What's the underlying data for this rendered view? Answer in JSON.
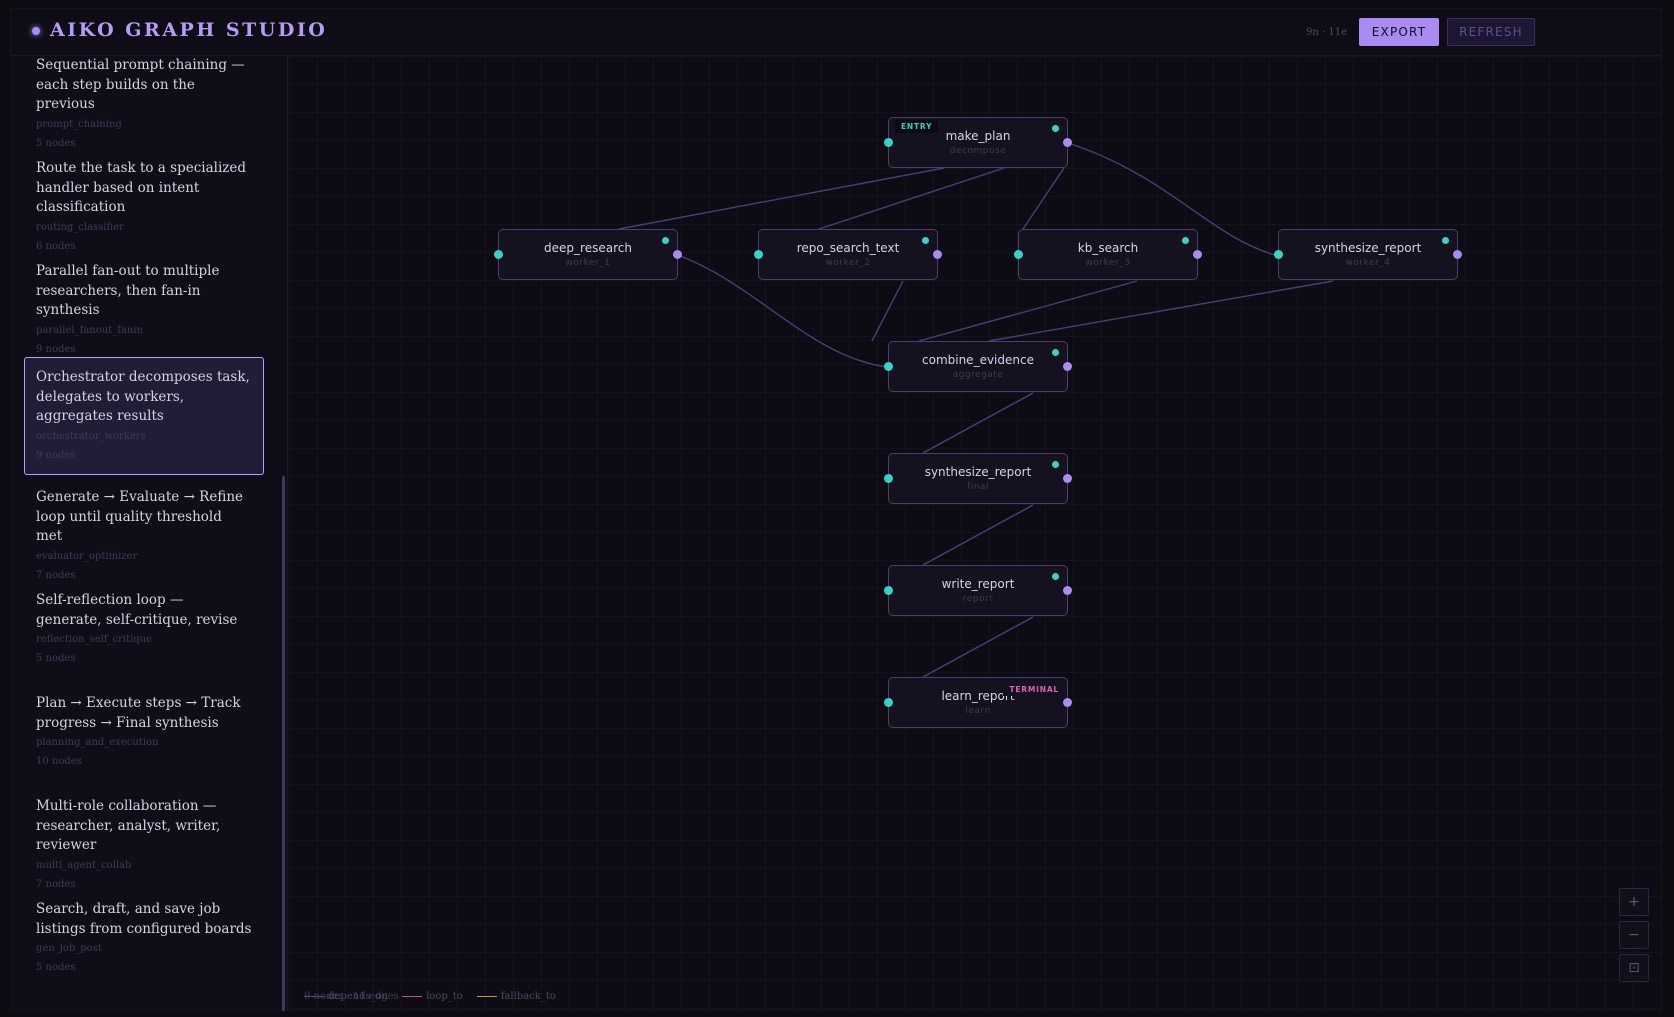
{
  "app": {
    "title": "AIKO GRAPH STUDIO",
    "counts": "9n · 11e"
  },
  "toolbar": {
    "export_label": "EXPORT",
    "refresh_label": "REFRESH"
  },
  "sidebar": {
    "items": [
      {
        "description": "Sequential prompt chaining — each step builds on the previous",
        "id": "prompt_chaining",
        "count": "5 nodes"
      },
      {
        "description": "Route the task to a specialized handler based on intent classification",
        "id": "routing_classifier",
        "count": "6 nodes"
      },
      {
        "description": "Parallel fan-out to multiple researchers, then fan-in synthesis",
        "id": "parallel_fanout_fanin",
        "count": "9 nodes"
      },
      {
        "description": "Orchestrator decomposes task, delegates to workers, aggregates results",
        "id": "orchestrator_workers",
        "count": "9 nodes",
        "active": true
      },
      {
        "description": "Generate → Evaluate → Refine loop until quality threshold met",
        "id": "evaluator_optimizer",
        "count": "7 nodes"
      },
      {
        "description": "Self-reflection loop — generate, self-critique, revise",
        "id": "reflection_self_critique",
        "count": "5 nodes"
      },
      {
        "description": "Plan → Execute steps → Track progress → Final synthesis",
        "id": "planning_and_execution",
        "count": "10 nodes"
      },
      {
        "description": "Multi-role collaboration — researcher, analyst, writer, reviewer",
        "id": "multi_agent_collab",
        "count": "7 nodes"
      },
      {
        "description": "Search, draft, and save job listings from configured boards",
        "id": "gen_job_post",
        "count": "5 nodes"
      }
    ]
  },
  "graph": {
    "nodes": [
      {
        "name": "make_plan",
        "role": "decompose",
        "badge": "ENTRY"
      },
      {
        "name": "deep_research",
        "role": "worker_1"
      },
      {
        "name": "repo_search_text",
        "role": "worker_2"
      },
      {
        "name": "kb_search",
        "role": "worker_3"
      },
      {
        "name": "synthesize_report",
        "role": "worker_4"
      },
      {
        "name": "combine_evidence",
        "role": "aggregate"
      },
      {
        "name": "synthesize_report",
        "role": "final"
      },
      {
        "name": "write_report",
        "role": "report"
      },
      {
        "name": "learn_report",
        "role": "learn",
        "badge": "TERMINAL"
      }
    ],
    "edges": [
      {
        "from": "make_plan",
        "to": "deep_research"
      },
      {
        "from": "make_plan",
        "to": "repo_search_text"
      },
      {
        "from": "make_plan",
        "to": "kb_search"
      },
      {
        "from": "make_plan",
        "to": "synthesize_report (worker_4)"
      },
      {
        "from": "deep_research",
        "to": "combine_evidence"
      },
      {
        "from": "repo_search_text",
        "to": "combine_evidence"
      },
      {
        "from": "kb_search",
        "to": "combine_evidence"
      },
      {
        "from": "synthesize_report (worker_4)",
        "to": "combine_evidence"
      },
      {
        "from": "combine_evidence",
        "to": "synthesize_report (final)"
      },
      {
        "from": "synthesize_report (final)",
        "to": "write_report"
      },
      {
        "from": "write_report",
        "to": "learn_report"
      }
    ]
  },
  "legend": {
    "overlap_text": "9 nodes · 11 edges",
    "items": [
      {
        "label": "depends_on",
        "color": "#5a4f86"
      },
      {
        "label": "loop_to",
        "color": "#c04f91"
      },
      {
        "label": "fallback_to",
        "color": "#e38a3b"
      }
    ]
  },
  "zoom": {
    "in": "+",
    "out": "−",
    "fit": "⊡"
  },
  "colors": {
    "accent": "#a98bf2",
    "port_in": "#39d2c6",
    "terminal": "#e45fb3",
    "edge": "#4a3f78"
  }
}
